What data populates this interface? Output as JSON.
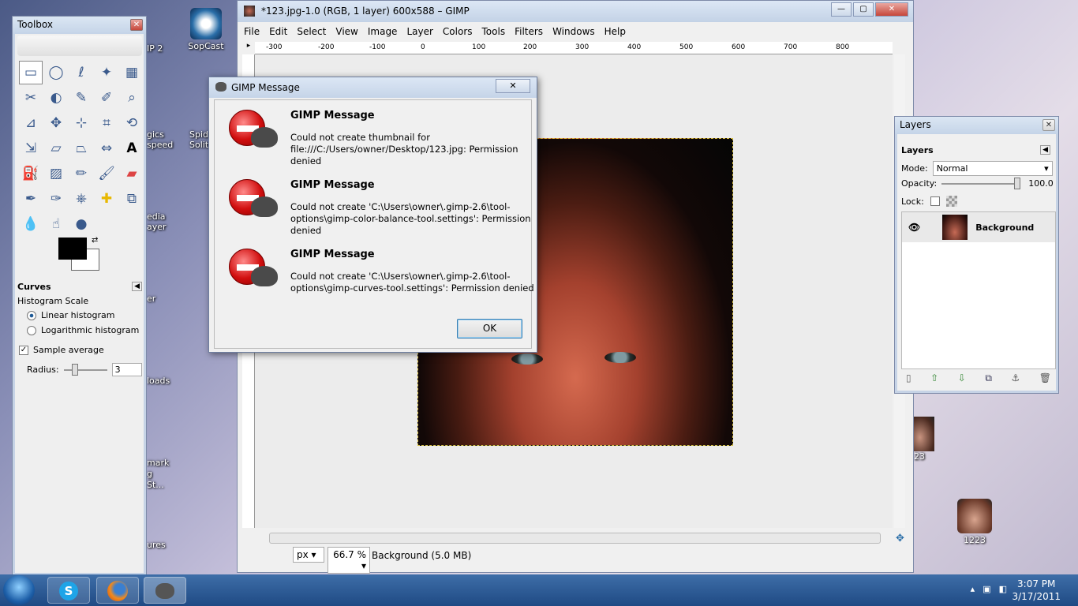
{
  "desktop": {
    "icons": [
      {
        "label": "SopCast"
      },
      {
        "label": "1223"
      }
    ],
    "partial_labels": [
      "IP 2",
      "gics",
      "speed",
      "Spid",
      "Solit",
      "edia",
      "ayer",
      "er",
      "loads",
      "mark",
      "g St...",
      "ures",
      "23"
    ]
  },
  "toolbox": {
    "title": "Toolbox",
    "tool_options": {
      "title": "Curves",
      "histogram_scale_label": "Histogram Scale",
      "linear": "Linear histogram",
      "log": "Logarithmic histogram",
      "sample_average": "Sample average",
      "radius_label": "Radius:",
      "radius_value": "3"
    }
  },
  "gimp": {
    "title": "*123.jpg-1.0 (RGB, 1 layer) 600x588 – GIMP",
    "menu": [
      "File",
      "Edit",
      "Select",
      "View",
      "Image",
      "Layer",
      "Colors",
      "Tools",
      "Filters",
      "Windows",
      "Help"
    ],
    "ruler_ticks": [
      "-300",
      "-200",
      "-100",
      "0",
      "100",
      "200",
      "300",
      "400",
      "500",
      "600",
      "700",
      "800"
    ],
    "status": {
      "unit": "px",
      "zoom": "66.7 %",
      "layer_info": "Background (5.0 MB)"
    }
  },
  "dialog": {
    "title": "GIMP Message",
    "close": "✕",
    "messages": [
      {
        "heading": "GIMP Message",
        "text": "Could not create thumbnail for file:///C:/Users/owner/Desktop/123.jpg: Permission denied"
      },
      {
        "heading": "GIMP Message",
        "text": "Could not create 'C:\\Users\\owner\\.gimp-2.6\\tool-options\\gimp-color-balance-tool.settings': Permission denied"
      },
      {
        "heading": "GIMP Message",
        "text": "Could not create 'C:\\Users\\owner\\.gimp-2.6\\tool-options\\gimp-curves-tool.settings': Permission denied"
      }
    ],
    "ok": "OK"
  },
  "layers": {
    "title": "Layers",
    "tab": "Layers",
    "mode_label": "Mode:",
    "mode_value": "Normal",
    "opacity_label": "Opacity:",
    "opacity_value": "100.0",
    "lock_label": "Lock:",
    "layer_name": "Background"
  },
  "taskbar": {
    "time": "3:07 PM",
    "date": "3/17/2011"
  },
  "colors": {
    "taskbar": "#1f4a84",
    "accent": "#3c7fb1"
  }
}
